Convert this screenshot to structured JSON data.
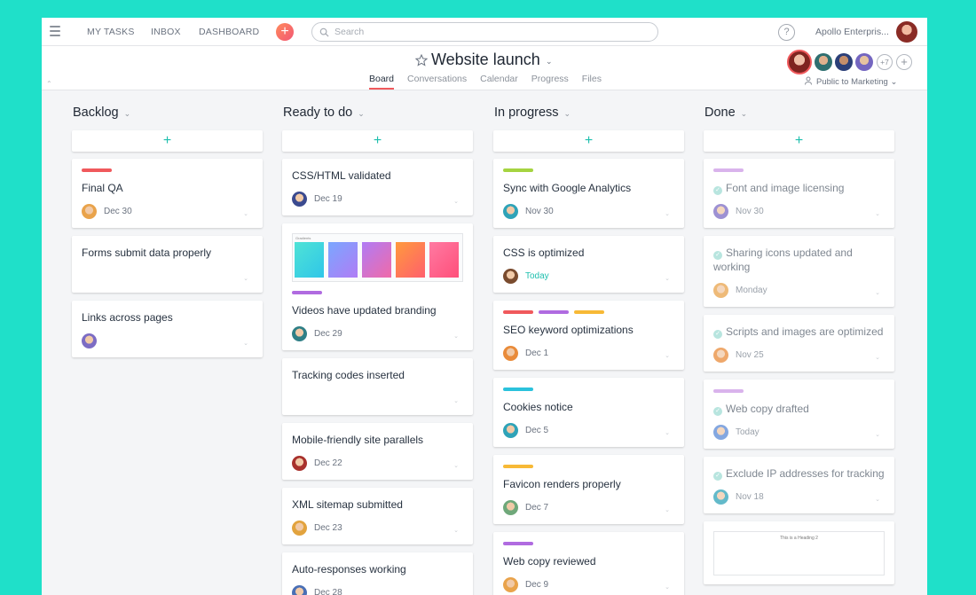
{
  "topbar": {
    "nav": [
      "MY TASKS",
      "INBOX",
      "DASHBOARD"
    ],
    "search_placeholder": "Search",
    "help": "?",
    "org": "Apollo Enterpris..."
  },
  "project": {
    "title": "Website launch",
    "tabs": [
      "Board",
      "Conversations",
      "Calendar",
      "Progress",
      "Files"
    ],
    "active_tab": "Board",
    "members_more": "+7",
    "privacy": "Public to Marketing"
  },
  "colors": {
    "accent": "#f0595c",
    "teal": "#1ebfae",
    "background": "#1fe0c9"
  },
  "columns": [
    {
      "title": "Backlog",
      "cards": [
        {
          "tags": [
            "#f0595c"
          ],
          "title": "Final QA",
          "due": "Dec 30",
          "avatar": "#e9a34b",
          "done": false
        },
        {
          "tags": [],
          "title": "Forms submit data properly",
          "due": "",
          "avatar": "",
          "done": false
        },
        {
          "tags": [],
          "title": "Links across pages",
          "due": "",
          "avatar": "#7c6cc4",
          "done": false
        }
      ]
    },
    {
      "title": "Ready to do",
      "cards": [
        {
          "tags": [],
          "title": "CSS/HTML validated",
          "due": "Dec 19",
          "avatar": "#3b4a8f",
          "done": false
        },
        {
          "tags": [
            "#b06be0"
          ],
          "title": "Videos have updated branding",
          "due": "Dec 29",
          "avatar": "#2f7f86",
          "done": false,
          "thumb": true,
          "thumb_title": "Gradients"
        },
        {
          "tags": [],
          "title": "Tracking codes inserted",
          "due": "",
          "avatar": "",
          "done": false
        },
        {
          "tags": [],
          "title": "Mobile-friendly site parallels",
          "due": "Dec 22",
          "avatar": "#a8312c",
          "done": false
        },
        {
          "tags": [],
          "title": "XML sitemap submitted",
          "due": "Dec 23",
          "avatar": "#e2a33e",
          "done": false
        },
        {
          "tags": [],
          "title": "Auto-responses working",
          "due": "Dec 28",
          "avatar": "#4a6fb5",
          "done": false
        }
      ]
    },
    {
      "title": "In progress",
      "cards": [
        {
          "tags": [
            "#a5d441"
          ],
          "title": "Sync with Google Analytics",
          "due": "Nov 30",
          "avatar": "#2fa3b8",
          "done": false
        },
        {
          "tags": [],
          "title": "CSS is optimized",
          "due": "Today",
          "today": true,
          "avatar": "#7a4b2e",
          "done": false
        },
        {
          "tags": [
            "#f0595c",
            "#b06be0",
            "#f7b936"
          ],
          "title": "SEO keyword optimizations",
          "due": "Dec 1",
          "avatar": "#e98b3a",
          "done": false
        },
        {
          "tags": [
            "#2bc2dc"
          ],
          "title": "Cookies notice",
          "due": "Dec 5",
          "avatar": "#2fa3b8",
          "done": false
        },
        {
          "tags": [
            "#f7b936"
          ],
          "title": "Favicon renders properly",
          "due": "Dec 7",
          "avatar": "#6fa87a",
          "done": false
        },
        {
          "tags": [
            "#b06be0"
          ],
          "title": "Web copy reviewed",
          "due": "Dec 9",
          "avatar": "#e9a34b",
          "done": false
        }
      ]
    },
    {
      "title": "Done",
      "cards": [
        {
          "tags": [
            "#d9b3ec"
          ],
          "title": "Font and image licensing",
          "due": "Nov 30",
          "avatar": "#7c6cc4",
          "done": true
        },
        {
          "tags": [],
          "title": "Sharing icons updated and working",
          "due": "Monday",
          "avatar": "#e9a34b",
          "done": true
        },
        {
          "tags": [],
          "title": "Scripts and images are optimized",
          "due": "Nov 25",
          "avatar": "#e98b3a",
          "done": true
        },
        {
          "tags": [
            "#d9b3ec"
          ],
          "title": "Web copy drafted",
          "due": "Today",
          "today": true,
          "avatar": "#5b8ad6",
          "done": true
        },
        {
          "tags": [],
          "title": "Exclude IP addresses for tracking",
          "due": "Nov 18",
          "avatar": "#2fa3b8",
          "done": true
        },
        {
          "tags": [],
          "title": "",
          "due": "",
          "avatar": "",
          "done": true,
          "doc": true,
          "doc_title": "This is a Heading 2"
        }
      ]
    }
  ]
}
